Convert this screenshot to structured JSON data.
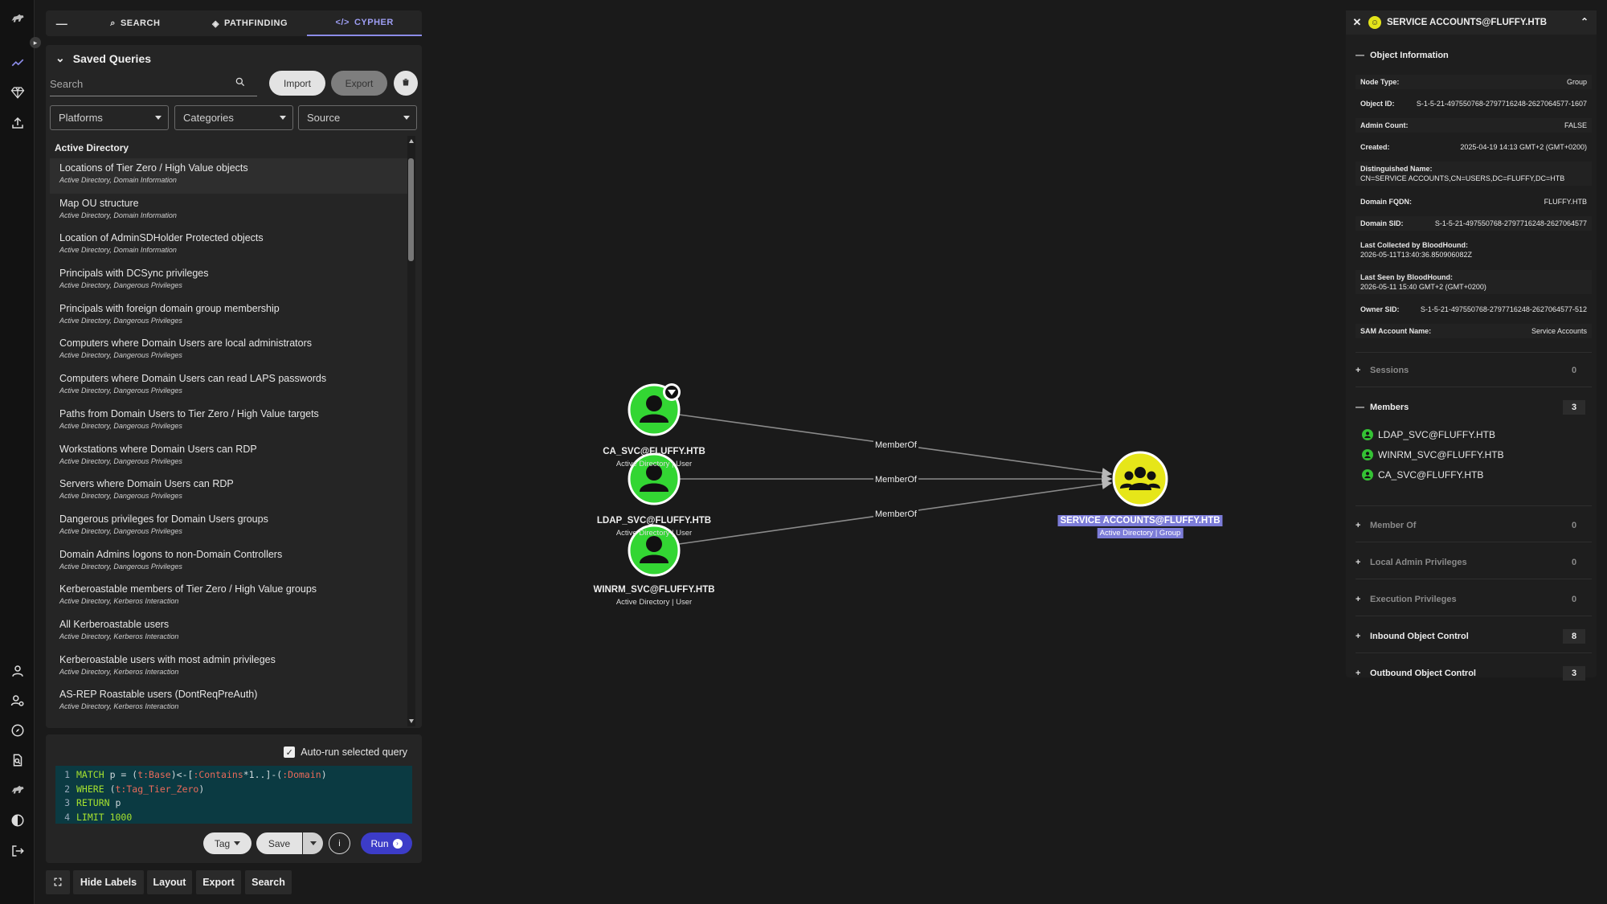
{
  "tabs": [
    {
      "label": "SEARCH",
      "icon": "search-icon"
    },
    {
      "label": "PATHFINDING",
      "icon": "route-icon"
    },
    {
      "label": "CYPHER",
      "icon": "code-icon"
    }
  ],
  "saved_queries": {
    "title": "Saved Queries",
    "search_placeholder": "Search",
    "import_label": "Import",
    "export_label": "Export",
    "filters": [
      "Platforms",
      "Categories",
      "Source"
    ],
    "group_title": "Active Directory",
    "items": [
      {
        "title": "Locations of Tier Zero / High Value objects",
        "sub": "Active Directory, Domain Information"
      },
      {
        "title": "Map OU structure",
        "sub": "Active Directory, Domain Information"
      },
      {
        "title": "Location of AdminSDHolder Protected objects",
        "sub": "Active Directory, Domain Information"
      },
      {
        "title": "Principals with DCSync privileges",
        "sub": "Active Directory, Dangerous Privileges"
      },
      {
        "title": "Principals with foreign domain group membership",
        "sub": "Active Directory, Dangerous Privileges"
      },
      {
        "title": "Computers where Domain Users are local administrators",
        "sub": "Active Directory, Dangerous Privileges"
      },
      {
        "title": "Computers where Domain Users can read LAPS passwords",
        "sub": "Active Directory, Dangerous Privileges"
      },
      {
        "title": "Paths from Domain Users to Tier Zero / High Value targets",
        "sub": "Active Directory, Dangerous Privileges"
      },
      {
        "title": "Workstations where Domain Users can RDP",
        "sub": "Active Directory, Dangerous Privileges"
      },
      {
        "title": "Servers where Domain Users can RDP",
        "sub": "Active Directory, Dangerous Privileges"
      },
      {
        "title": "Dangerous privileges for Domain Users groups",
        "sub": "Active Directory, Dangerous Privileges"
      },
      {
        "title": "Domain Admins logons to non-Domain Controllers",
        "sub": "Active Directory, Dangerous Privileges"
      },
      {
        "title": "Kerberoastable members of Tier Zero / High Value groups",
        "sub": "Active Directory, Kerberos Interaction"
      },
      {
        "title": "All Kerberoastable users",
        "sub": "Active Directory, Kerberos Interaction"
      },
      {
        "title": "Kerberoastable users with most admin privileges",
        "sub": "Active Directory, Kerberos Interaction"
      },
      {
        "title": "AS-REP Roastable users (DontReqPreAuth)",
        "sub": "Active Directory, Kerberos Interaction"
      }
    ]
  },
  "editor": {
    "autorun_label": "Auto-run selected query",
    "lines": [
      {
        "n": "1",
        "text": "MATCH p = (t:Base)<-[:Contains*1..]-(:Domain)"
      },
      {
        "n": "2",
        "text": "WHERE (t:Tag_Tier_Zero)"
      },
      {
        "n": "3",
        "text": "RETURN p"
      },
      {
        "n": "4",
        "text": "LIMIT 1000"
      }
    ],
    "tag_label": "Tag",
    "save_label": "Save",
    "run_label": "Run"
  },
  "toolbar": {
    "hide_labels": "Hide Labels",
    "layout": "Layout",
    "export": "Export",
    "search": "Search"
  },
  "graph": {
    "nodes": [
      {
        "name": "CA_SVC@FLUFFY.HTB",
        "sub": "Active Directory | User"
      },
      {
        "name": "LDAP_SVC@FLUFFY.HTB",
        "sub": "Active Directory | User"
      },
      {
        "name": "WINRM_SVC@FLUFFY.HTB",
        "sub": "Active Directory | User"
      },
      {
        "name": "SERVICE ACCOUNTS@FLUFFY.HTB",
        "sub": "Active Directory | Group"
      }
    ],
    "edges": [
      "MemberOf",
      "MemberOf",
      "MemberOf"
    ],
    "user_color": "#33d633",
    "group_color": "#e6e619"
  },
  "details": {
    "title": "SERVICE ACCOUNTS@FLUFFY.HTB",
    "object_info_title": "Object Information",
    "props": [
      {
        "k": "Node Type:",
        "v": "Group"
      },
      {
        "k": "Object ID:",
        "v": "S-1-5-21-497550768-2797716248-2627064577-1607"
      },
      {
        "k": "Admin Count:",
        "v": "FALSE"
      },
      {
        "k": "Created:",
        "v": "2025-04-19 14:13 GMT+2 (GMT+0200)"
      },
      {
        "k": "Distinguished Name:",
        "v": "CN=SERVICE ACCOUNTS,CN=USERS,DC=FLUFFY,DC=HTB"
      },
      {
        "k": "Domain FQDN:",
        "v": "FLUFFY.HTB"
      },
      {
        "k": "Domain SID:",
        "v": "S-1-5-21-497550768-2797716248-2627064577"
      },
      {
        "k": "Last Collected by BloodHound:",
        "v": "2026-05-11T13:40:36.850906082Z"
      },
      {
        "k": "Last Seen by BloodHound:",
        "v": "2026-05-11 15:40 GMT+2 (GMT+0200)"
      },
      {
        "k": "Owner SID:",
        "v": "S-1-5-21-497550768-2797716248-2627064577-512"
      },
      {
        "k": "SAM Account Name:",
        "v": "Service Accounts"
      }
    ],
    "sections": [
      {
        "label": "Sessions",
        "count": "0"
      },
      {
        "label": "Members",
        "count": "3"
      },
      {
        "label": "Member Of",
        "count": "0"
      },
      {
        "label": "Local Admin Privileges",
        "count": "0"
      },
      {
        "label": "Execution Privileges",
        "count": "0"
      },
      {
        "label": "Inbound Object Control",
        "count": "8"
      },
      {
        "label": "Outbound Object Control",
        "count": "3"
      }
    ],
    "members": [
      "LDAP_SVC@FLUFFY.HTB",
      "WINRM_SVC@FLUFFY.HTB",
      "CA_SVC@FLUFFY.HTB"
    ]
  }
}
